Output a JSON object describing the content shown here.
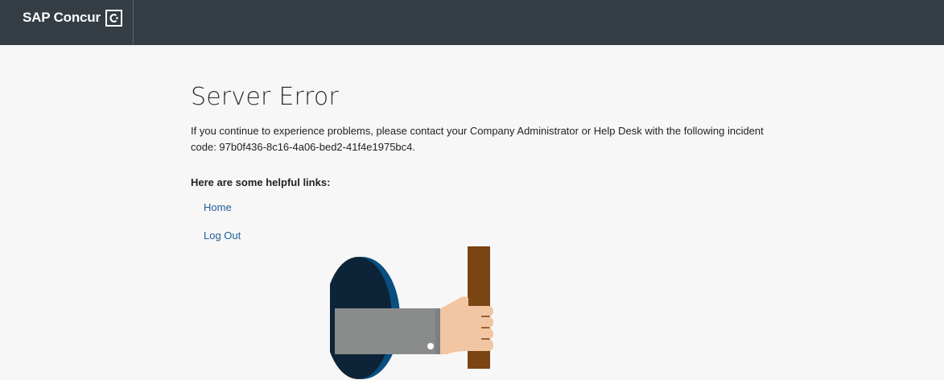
{
  "header": {
    "brand": "SAP Concur"
  },
  "main": {
    "title": "Server Error",
    "message": "If you continue to experience problems, please contact your Company Administrator or Help Desk with the following incident code: 97b0f436-8c16-4a06-bed2-41f4e1975bc4.",
    "links_heading": "Here are some helpful links:",
    "links": [
      {
        "label": "Home"
      },
      {
        "label": "Log Out"
      }
    ]
  },
  "colors": {
    "header_bg": "#353d45",
    "page_bg": "#f7f7f7",
    "link": "#1f5d99",
    "hole_dark": "#0d2438",
    "hole_rim": "#0a4f80",
    "sleeve": "#8a8c8c",
    "hand": "#f2c6a2",
    "stick": "#7a4413"
  }
}
